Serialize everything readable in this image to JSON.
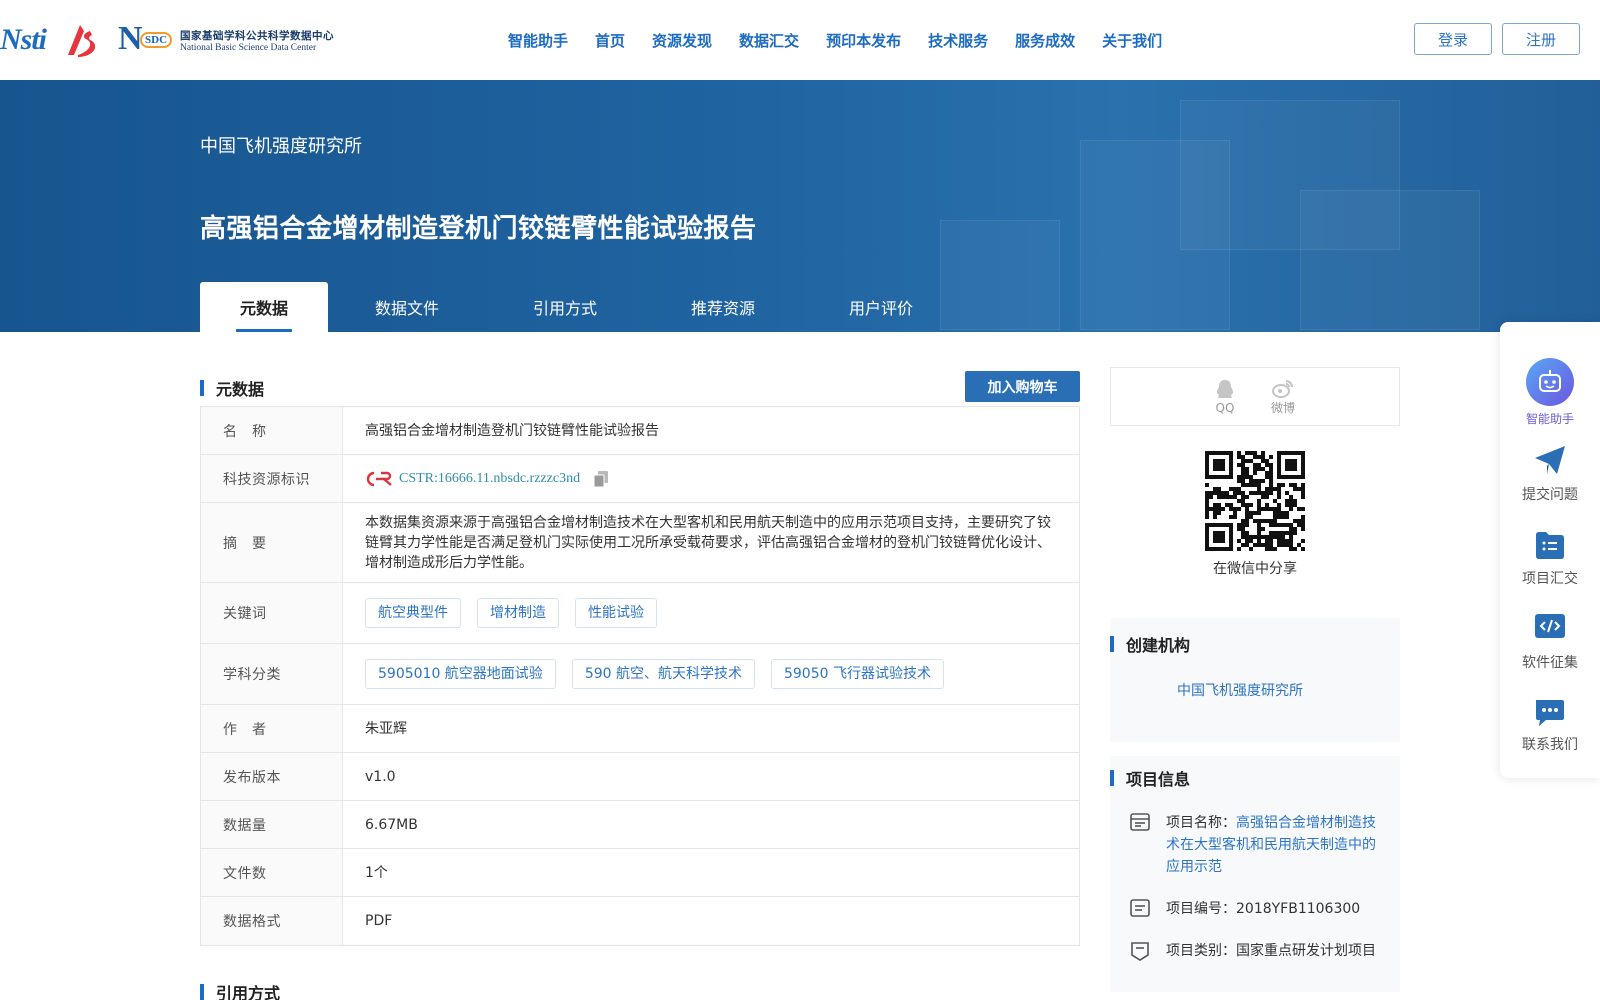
{
  "header": {
    "logo_nsti": "Nsti",
    "logo_nsdc_cn": "国家基础学科公共科学数据中心",
    "logo_nsdc_en": "National Basic Science Data Center",
    "nav": [
      "智能助手",
      "首页",
      "资源发现",
      "数据汇交",
      "预印本发布",
      "技术服务",
      "服务成效",
      "关于我们"
    ],
    "login": "登录",
    "register": "注册"
  },
  "banner": {
    "org": "中国飞机强度研究所",
    "title": "高强铝合金增材制造登机门铰链臂性能试验报告",
    "tabs": [
      "元数据",
      "数据文件",
      "引用方式",
      "推荐资源",
      "用户评价"
    ],
    "active_tab": 0
  },
  "metadata": {
    "section_title": "元数据",
    "cart_button": "加入购物车",
    "rows": {
      "name": {
        "label": "名　称",
        "value": "高强铝合金增材制造登机门铰链臂性能试验报告"
      },
      "cstr": {
        "label": "科技资源标识",
        "value": "CSTR:16666.11.nbsdc.rzzzc3nd"
      },
      "abstract": {
        "label": "摘　要",
        "value": "本数据集资源来源于高强铝合金增材制造技术在大型客机和民用航天制造中的应用示范项目支持，主要研究了铰链臂其力学性能是否满足登机门实际使用工况所承受载荷要求，评估高强铝合金增材的登机门铰链臂优化设计、增材制造成形后力学性能。"
      },
      "keywords": {
        "label": "关键词",
        "tags": [
          "航空典型件",
          "增材制造",
          "性能试验"
        ]
      },
      "subjects": {
        "label": "学科分类",
        "tags": [
          "5905010 航空器地面试验",
          "590 航空、航天科学技术",
          "59050 飞行器试验技术"
        ]
      },
      "author": {
        "label": "作　者",
        "value": "朱亚辉"
      },
      "version": {
        "label": "发布版本",
        "value": "v1.0"
      },
      "size": {
        "label": "数据量",
        "value": "6.67MB"
      },
      "files": {
        "label": "文件数",
        "value": "1个"
      },
      "format": {
        "label": "数据格式",
        "value": "PDF"
      }
    }
  },
  "citation": {
    "section_title": "引用方式"
  },
  "share": {
    "qq": "QQ",
    "weibo": "微博",
    "wechat_caption": "在微信中分享"
  },
  "creator": {
    "section_title": "创建机构",
    "org": "中国飞机强度研究所"
  },
  "project": {
    "section_title": "项目信息",
    "name_label": "项目名称：",
    "name_line1": "高强铝合金增材制造技",
    "name_line2": "术在大型客机和民用航天制造中的",
    "name_line3": "应用示范",
    "number": "项目编号：2018YFB1106300",
    "category": "项目类别：国家重点研发计划项目"
  },
  "floatbar": {
    "assistant": "智能助手",
    "submit_question": "提交问题",
    "project_submit": "项目汇交",
    "software": "软件征集",
    "contact": "联系我们"
  },
  "colors": {
    "primary": "#1e6cc2",
    "banner": "#1f63a0",
    "button": "#2a6fb5"
  }
}
